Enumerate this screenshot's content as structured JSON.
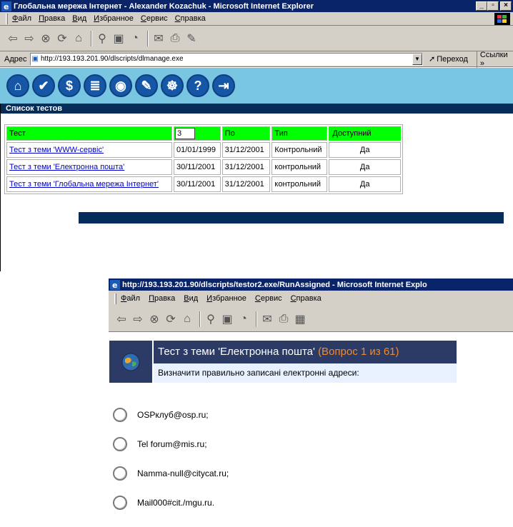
{
  "win1": {
    "title": "Глобальна мережа Інтернет - Alexander Kozachuk - Microsoft Internet Explorer",
    "menu": [
      "Файл",
      "Правка",
      "Вид",
      "Избранное",
      "Сервис",
      "Справка"
    ],
    "address_label": "Адрес",
    "address_url": "http://193.193.201.90/dlscripts/dlmanage.exe",
    "go_label": "Переход",
    "links_label": "Ссылки »",
    "section_title": "Список тестов",
    "table": {
      "header": {
        "test": "Тест",
        "count_input": "3",
        "to": "По",
        "type": "Тип",
        "available": "Доступний"
      },
      "rows": [
        {
          "test": "Тест з теми 'WWW-сервіс'",
          "from": "01/01/1999",
          "to": "31/12/2001",
          "type": "Контрольний",
          "available": "Да"
        },
        {
          "test": "Тест з теми 'Електронна пошта'",
          "from": "30/11/2001",
          "to": "31/12/2001",
          "type": "контрольний",
          "available": "Да"
        },
        {
          "test": "Тест з теми 'Глобальна мережа Інтернет'",
          "from": "30/11/2001",
          "to": "31/12/2001",
          "type": "контрольний",
          "available": "Да"
        }
      ]
    },
    "nav_icons": [
      "home-icon",
      "document-icon",
      "money-icon",
      "books-icon",
      "speech-icon",
      "edit-icon",
      "network-icon",
      "help-icon",
      "exit-icon"
    ]
  },
  "win2": {
    "title": "http://193.193.201.90/dlscripts/testor2.exe/RunAssigned - Microsoft Internet Explo",
    "menu": [
      "Файл",
      "Правка",
      "Вид",
      "Избранное",
      "Сервис",
      "Справка"
    ],
    "question_title": "Тест з теми 'Електронна пошта'",
    "question_count": "(Вопрос 1 из 61)",
    "question_prompt": "Визначити правильно записані електронні адреси:",
    "answers": [
      "OSPклуб@osp.ru;",
      "Tel forum@mis.ru;",
      "Namma-null@citycat.ru;",
      "Mail000#cit./mgu.ru."
    ]
  },
  "colors": {
    "title_bar": "#0a246a",
    "nav_strip": "#79c6e3",
    "nav_dark": "#062c59",
    "header_green": "#00ff00",
    "question_bg": "#2c3a66",
    "question_count": "#f08a2c"
  }
}
